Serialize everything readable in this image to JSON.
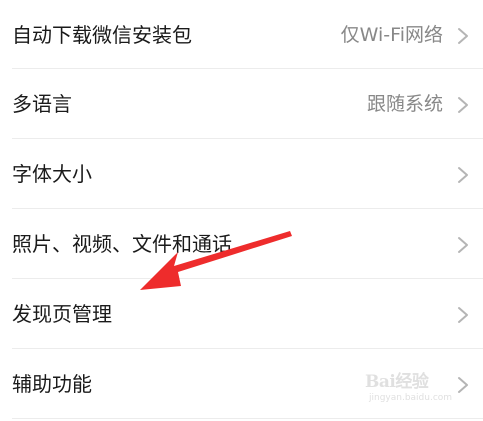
{
  "settings": {
    "items": [
      {
        "label": "自动下载微信安装包",
        "value": "仅Wi-Fi网络"
      },
      {
        "label": "多语言",
        "value": "跟随系统"
      },
      {
        "label": "字体大小",
        "value": ""
      },
      {
        "label": "照片、视频、文件和通话",
        "value": ""
      },
      {
        "label": "发现页管理",
        "value": ""
      },
      {
        "label": "辅助功能",
        "value": ""
      }
    ]
  },
  "annotation": {
    "arrow_color": "#ee2c2c",
    "points_to": "发现页管理"
  },
  "watermark": {
    "brand": "Bai经验",
    "url": "jingyan.baidu.com"
  },
  "colors": {
    "background": "#ffffff",
    "text_primary": "#1a1a1a",
    "text_secondary": "#888888",
    "divider": "#ececec",
    "chevron": "#b5b5b5"
  },
  "icons": {
    "chevron": "chevron-right-icon",
    "arrow": "red-annotation-arrow-icon"
  }
}
